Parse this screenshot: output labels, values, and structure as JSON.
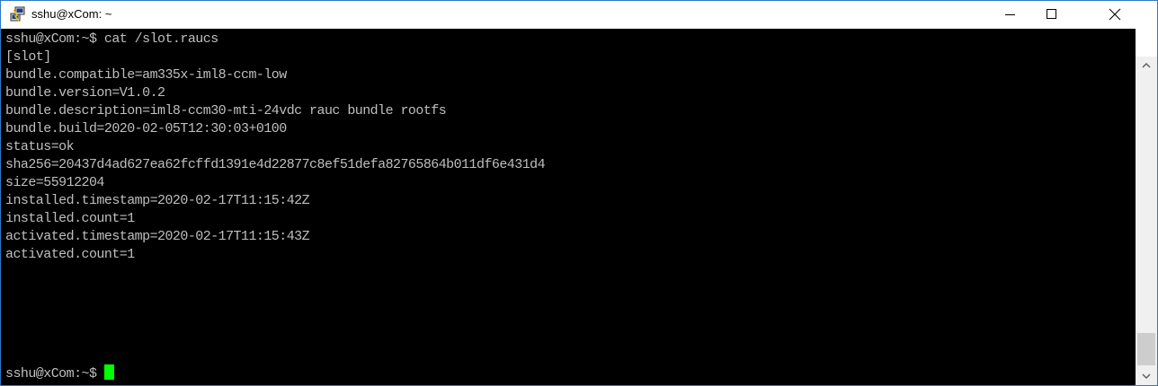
{
  "window": {
    "title": "sshu@xCom: ~",
    "icon": "putty-icon",
    "controls": [
      "minimize-icon",
      "maximize-icon",
      "close-icon"
    ]
  },
  "terminal": {
    "lines": [
      "sshu@xCom:~$ cat /slot.raucs",
      "[slot]",
      "bundle.compatible=am335x-iml8-ccm-low",
      "bundle.version=V1.0.2",
      "bundle.description=iml8-ccm30-mti-24vdc rauc bundle rootfs",
      "bundle.build=2020-02-05T12:30:03+0100",
      "status=ok",
      "sha256=20437d4ad627ea62fcffd1391e4d22877c8ef51defa82765864b011df6e431d4",
      "size=55912204",
      "installed.timestamp=2020-02-17T11:15:42Z",
      "installed.count=1",
      "activated.timestamp=2020-02-17T11:15:43Z",
      "activated.count=1"
    ],
    "prompt": "sshu@xCom:~$ ",
    "text_color": "#bfbfbf",
    "background_color": "#000000",
    "cursor_color": "#00ff00"
  },
  "scrollbar": {
    "up_icon": "chevron-up-icon",
    "down_icon": "chevron-down-icon"
  }
}
